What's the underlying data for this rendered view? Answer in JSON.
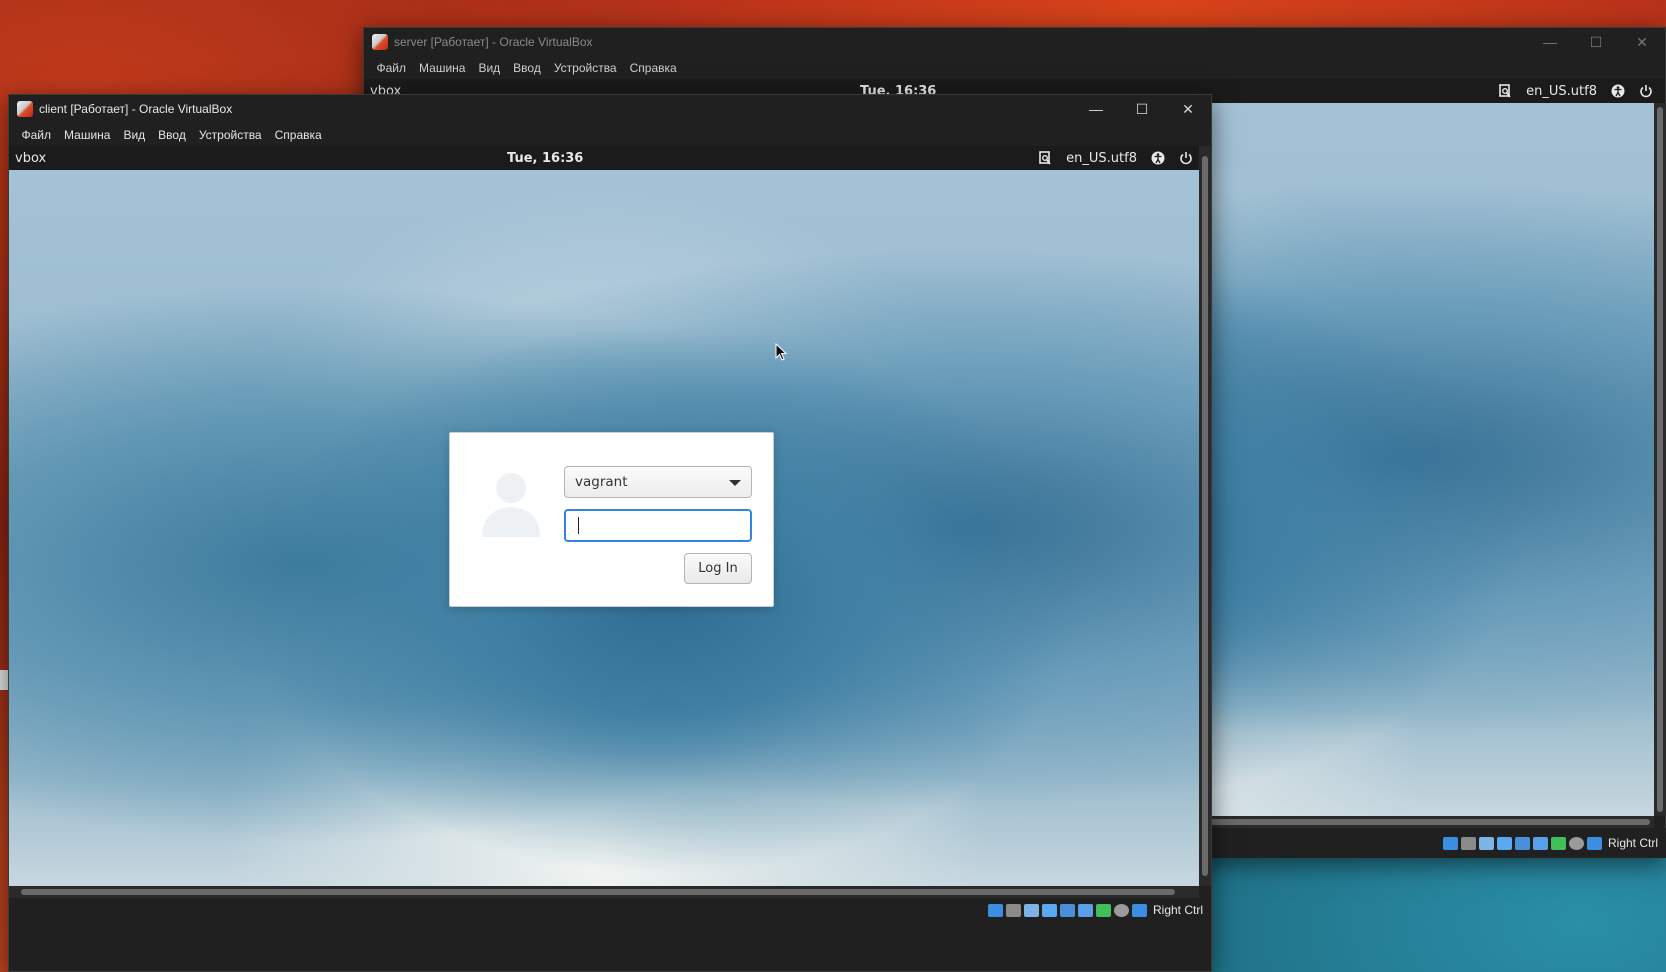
{
  "server_window": {
    "title": "server [Работает] - Oracle VirtualBox",
    "menu": [
      "Файл",
      "Машина",
      "Вид",
      "Ввод",
      "Устройства",
      "Справка"
    ],
    "guest_panel": {
      "activities": "vbox",
      "clock": "Tue, 16:36",
      "locale": "en_US.utf8"
    },
    "status": {
      "host_key": "Right Ctrl"
    }
  },
  "client_window": {
    "title": "client [Работает] - Oracle VirtualBox",
    "menu": [
      "Файл",
      "Машина",
      "Вид",
      "Ввод",
      "Устройства",
      "Справка"
    ],
    "guest_panel": {
      "activities": "vbox",
      "clock": "Tue, 16:36",
      "locale": "en_US.utf8"
    },
    "login": {
      "user_selected": "vagrant",
      "password_value": "",
      "login_button": "Log In"
    },
    "status": {
      "host_key": "Right Ctrl"
    }
  },
  "window_controls": {
    "minimize": "—",
    "maximize": "☐",
    "close": "✕"
  },
  "colors": {
    "accent_focus": "#3584e4",
    "titlebar": "#202020",
    "guest_panel": "#1b1b1b"
  }
}
